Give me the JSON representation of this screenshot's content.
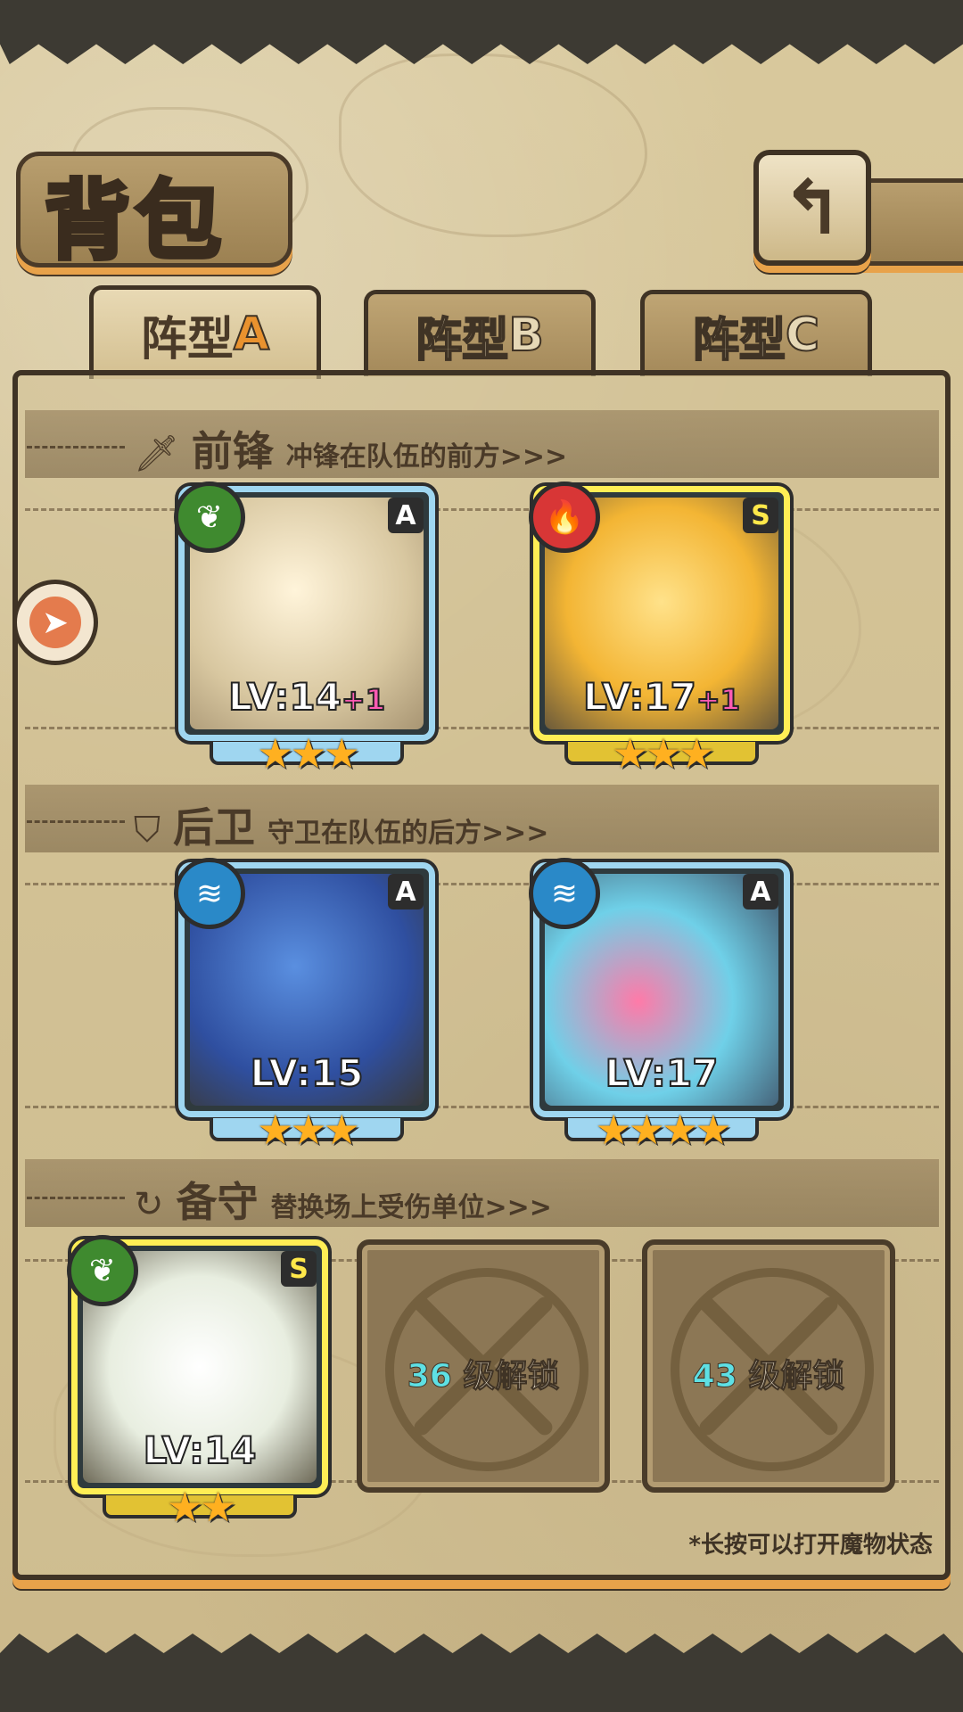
{
  "title": "背包",
  "back_icon": "back-arrow-icon",
  "tabs": [
    {
      "label": "阵型",
      "letter": "A",
      "active": true
    },
    {
      "label": "阵型",
      "letter": "B",
      "active": false
    },
    {
      "label": "阵型",
      "letter": "C",
      "active": false
    }
  ],
  "sections": {
    "front": {
      "name": "前锋",
      "desc": "冲锋在队伍的前方>>>",
      "icon": "sword-icon"
    },
    "back": {
      "name": "后卫",
      "desc": "守卫在队伍的后方>>>",
      "icon": "shield-icon"
    },
    "reserve": {
      "name": "备守",
      "desc": "替换场上受伤单位>>>",
      "icon": "swap-icon"
    }
  },
  "units": [
    {
      "slot": "front-1",
      "level": "LV:14",
      "bonus": "+1",
      "grade": "A",
      "element": "leaf",
      "stars": 3
    },
    {
      "slot": "front-2",
      "level": "LV:17",
      "bonus": "+1",
      "grade": "S",
      "element": "fire",
      "stars": 3
    },
    {
      "slot": "back-1",
      "level": "LV:15",
      "bonus": "",
      "grade": "A",
      "element": "water",
      "stars": 3
    },
    {
      "slot": "back-2",
      "level": "LV:17",
      "bonus": "",
      "grade": "A",
      "element": "water",
      "stars": 4
    },
    {
      "slot": "reserve-1",
      "level": "LV:14",
      "bonus": "",
      "grade": "S",
      "element": "leaf",
      "stars": 2
    }
  ],
  "locked_slots": [
    {
      "level": "36",
      "text": "级解锁"
    },
    {
      "level": "43",
      "text": "级解锁"
    }
  ],
  "side_button_icon": "pointer-icon",
  "hint": "*长按可以打开魔物状态",
  "colors": {
    "accent_orange": "#e9922e",
    "card_a": "#9fd6f0",
    "card_s": "#ffee55",
    "lock_num": "#5ee0e4",
    "plus": "#ff5bb4"
  }
}
